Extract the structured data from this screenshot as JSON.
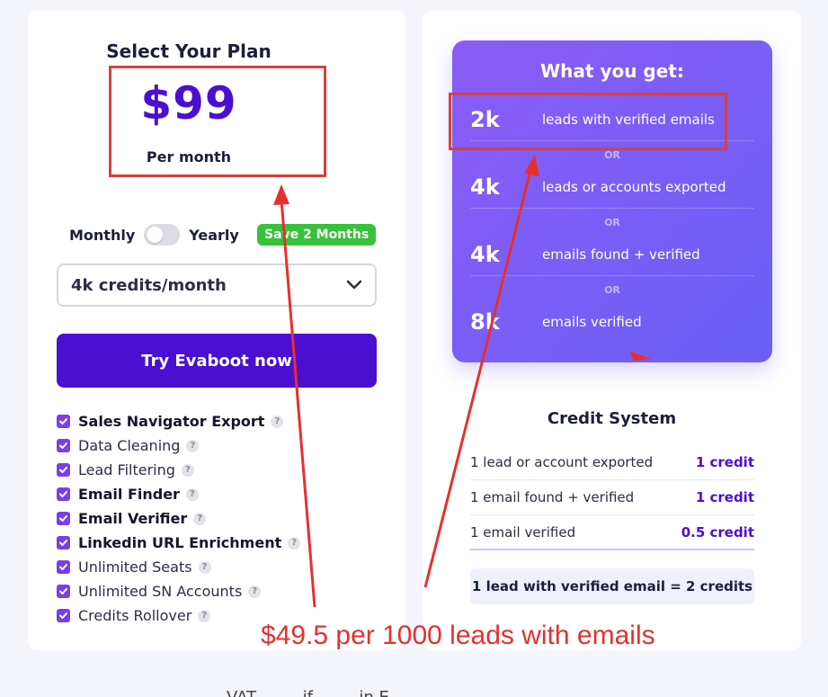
{
  "plan": {
    "title": "Select Your Plan",
    "price": "$99",
    "period": "Per month"
  },
  "billing": {
    "monthly_label": "Monthly",
    "yearly_label": "Yearly",
    "save_badge": "Save 2 Months"
  },
  "credits_select": {
    "value": "4k credits/month"
  },
  "cta": {
    "label": "Try Evaboot now"
  },
  "features": [
    {
      "label": "Sales Navigator Export",
      "bold": true
    },
    {
      "label": "Data Cleaning",
      "bold": false
    },
    {
      "label": "Lead Filtering",
      "bold": false
    },
    {
      "label": "Email Finder",
      "bold": true
    },
    {
      "label": "Email Verifier",
      "bold": true
    },
    {
      "label": "Linkedin URL Enrichment",
      "bold": true
    },
    {
      "label": "Unlimited Seats",
      "bold": false
    },
    {
      "label": "Unlimited SN Accounts",
      "bold": false
    },
    {
      "label": "Credits Rollover",
      "bold": false
    }
  ],
  "help_glyph": "?",
  "offer": {
    "title": "What you get:",
    "or_label": "OR",
    "items": [
      {
        "amount": "2k",
        "text": "leads with verified emails"
      },
      {
        "amount": "4k",
        "text": "leads or accounts exported"
      },
      {
        "amount": "4k",
        "text": "emails found + verified"
      },
      {
        "amount": "8k",
        "text": "emails verified"
      }
    ]
  },
  "credit_system": {
    "title": "Credit System",
    "rows": [
      {
        "desc": "1 lead or account exported",
        "value": "1 credit"
      },
      {
        "desc": "1 email found + verified",
        "value": "1 credit"
      },
      {
        "desc": "1 email verified",
        "value": "0.5 credit"
      }
    ],
    "summary": "1 lead with verified email = 2 credits"
  },
  "annotation": {
    "text": "$49.5 per 1000 leads with emails"
  },
  "footer": {
    "note": "VAT ... ... if ... ... in E..."
  },
  "colors": {
    "brand_purple": "#4a0fd1",
    "badge_green": "#36c23a",
    "annotation_red": "#e5302e"
  }
}
